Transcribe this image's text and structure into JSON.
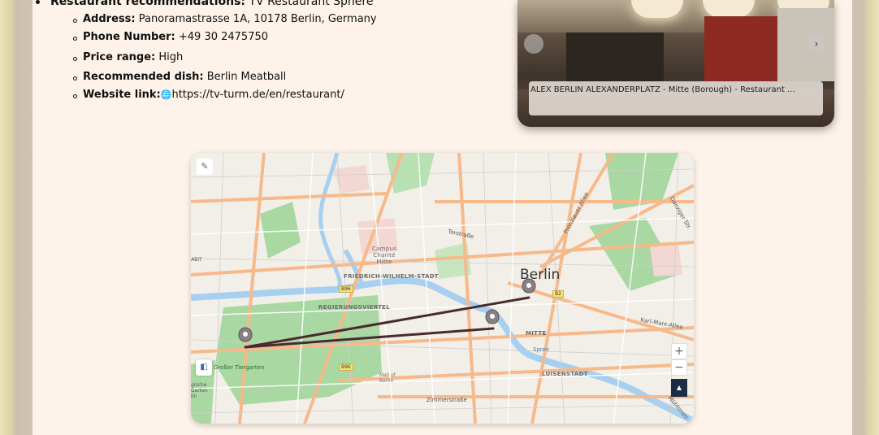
{
  "restaurant": {
    "heading_label": "Restaurant recommendations:",
    "heading_value": "TV Restaurant Sphere",
    "details": [
      {
        "label": "Address:",
        "value": "Panoramastrasse 1A, 10178 Berlin, Germany"
      },
      {
        "label": "Phone Number:",
        "value": "+49 30 2475750"
      },
      {
        "label": "Price range:",
        "value": "High"
      },
      {
        "label": "Recommended dish:",
        "value": "Berlin Meatball"
      },
      {
        "label": "Website link:",
        "value": "https://tv-turm.de/en/restaurant/"
      }
    ],
    "website_icon": "globe-icon"
  },
  "carousel": {
    "caption": "ALEX BERLIN ALEXANDERPLATZ - Mitte (Borough) - Restaurant ...",
    "prev_icon": "chevron-left-icon",
    "next_icon": "chevron-right-icon",
    "next_glyph": "›"
  },
  "map": {
    "city_label": "Berlin",
    "districts": [
      "Campus Charité Mitte",
      "FRIEDRICH-WILHELM-STADT",
      "REGIERUNGSVIERTEL",
      "MITTE",
      "LUISENSTADT"
    ],
    "streets": [
      "Torstraße",
      "Prenzlauer Allee",
      "Karl-Marx-Allee",
      "Spree",
      "Zimmerstraße",
      "Mall of Berlin",
      "Großer Tiergarten",
      "Danziger Str.",
      "Mühlenstr."
    ],
    "shields": [
      "B96",
      "B2",
      "B96"
    ],
    "edge_labels": [
      "ABIT",
      "gische Garten lin"
    ],
    "zoom_in": "+",
    "zoom_out": "−",
    "route_color": "#4a2a30",
    "marker_color": "#8a7f83"
  }
}
